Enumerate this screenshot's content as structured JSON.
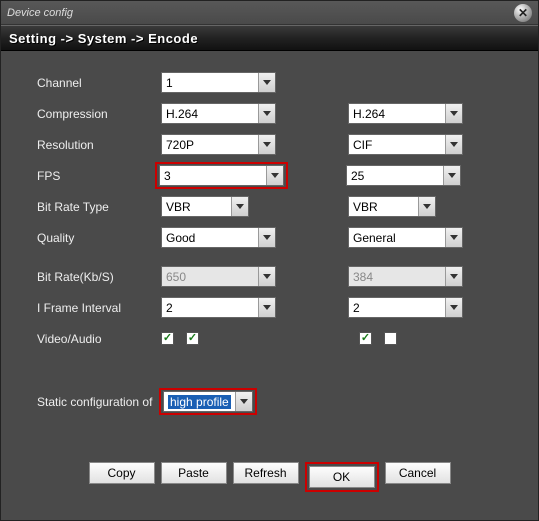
{
  "window": {
    "title": "Device config"
  },
  "breadcrumb": "Setting -> System -> Encode",
  "labels": {
    "channel": "Channel",
    "compression": "Compression",
    "resolution": "Resolution",
    "fps": "FPS",
    "bitrate_type": "Bit Rate Type",
    "quality": "Quality",
    "bitrate": "Bit Rate(Kb/S)",
    "iframe": "I Frame Interval",
    "video_audio": "Video/Audio",
    "static_conf": "Static configuration of"
  },
  "main": {
    "channel": "1",
    "compression": "H.264",
    "resolution": "720P",
    "fps": "3",
    "bitrate_type": "VBR",
    "quality": "Good",
    "bitrate": "650",
    "iframe": "2",
    "video_checked": true,
    "audio_checked": true
  },
  "sub": {
    "compression": "H.264",
    "resolution": "CIF",
    "fps": "25",
    "bitrate_type": "VBR",
    "quality": "General",
    "bitrate": "384",
    "iframe": "2",
    "video_checked": true,
    "audio_checked": false
  },
  "static_profile": "high profile",
  "buttons": {
    "copy": "Copy",
    "paste": "Paste",
    "refresh": "Refresh",
    "ok": "OK",
    "cancel": "Cancel"
  }
}
